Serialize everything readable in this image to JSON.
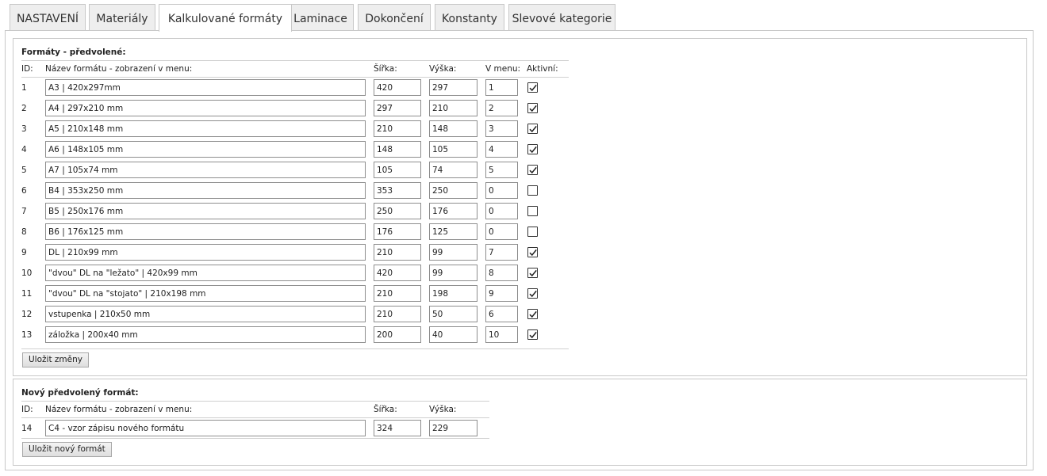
{
  "tabs": [
    {
      "label": "NASTAVENÍ"
    },
    {
      "label": "Materiály"
    },
    {
      "label": "Kalkulované formáty"
    },
    {
      "label": "Laminace"
    },
    {
      "label": "Dokončení"
    },
    {
      "label": "Konstanty"
    },
    {
      "label": "Slevové kategorie"
    }
  ],
  "active_tab": "Kalkulované formáty",
  "presets": {
    "title": "Formáty - předvolené:",
    "headers": {
      "id": "ID:",
      "name": "Název formátu - zobrazení v menu:",
      "width": "Šířka:",
      "height": "Výška:",
      "menu": "V menu:",
      "active": "Aktivní:"
    },
    "rows": [
      {
        "id": "1",
        "name": "A3 | 420x297mm",
        "width": "420",
        "height": "297",
        "menu": "1",
        "active": true
      },
      {
        "id": "2",
        "name": "A4 | 297x210 mm",
        "width": "297",
        "height": "210",
        "menu": "2",
        "active": true
      },
      {
        "id": "3",
        "name": "A5 | 210x148 mm",
        "width": "210",
        "height": "148",
        "menu": "3",
        "active": true
      },
      {
        "id": "4",
        "name": "A6 | 148x105 mm",
        "width": "148",
        "height": "105",
        "menu": "4",
        "active": true
      },
      {
        "id": "5",
        "name": "A7 | 105x74 mm",
        "width": "105",
        "height": "74",
        "menu": "5",
        "active": true
      },
      {
        "id": "6",
        "name": "B4 | 353x250 mm",
        "width": "353",
        "height": "250",
        "menu": "0",
        "active": false
      },
      {
        "id": "7",
        "name": "B5 | 250x176 mm",
        "width": "250",
        "height": "176",
        "menu": "0",
        "active": false
      },
      {
        "id": "8",
        "name": "B6 | 176x125 mm",
        "width": "176",
        "height": "125",
        "menu": "0",
        "active": false
      },
      {
        "id": "9",
        "name": "DL | 210x99 mm",
        "width": "210",
        "height": "99",
        "menu": "7",
        "active": true
      },
      {
        "id": "10",
        "name": "\"dvou\" DL na \"ležato\" | 420x99 mm",
        "width": "420",
        "height": "99",
        "menu": "8",
        "active": true
      },
      {
        "id": "11",
        "name": "\"dvou\" DL na \"stojato\" | 210x198 mm",
        "width": "210",
        "height": "198",
        "menu": "9",
        "active": true
      },
      {
        "id": "12",
        "name": "vstupenka | 210x50 mm",
        "width": "210",
        "height": "50",
        "menu": "6",
        "active": true
      },
      {
        "id": "13",
        "name": "záložka | 200x40 mm",
        "width": "200",
        "height": "40",
        "menu": "10",
        "active": true
      }
    ],
    "save_label": "Uložit změny"
  },
  "new_format": {
    "title": "Nový předvolený formát:",
    "headers": {
      "id": "ID:",
      "name": "Název formátu - zobrazení v menu:",
      "width": "Šířka:",
      "height": "Výška:"
    },
    "row": {
      "id": "14",
      "name": "C4 - vzor zápisu nového formátu",
      "width": "324",
      "height": "229"
    },
    "save_label": "Uložit nový formát"
  }
}
